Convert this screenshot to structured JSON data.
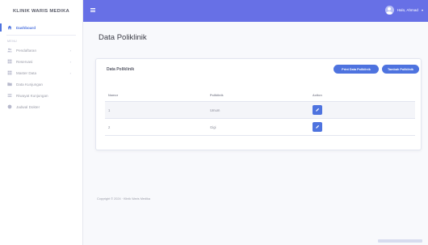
{
  "sidebar": {
    "brand": "KLINIK WARIS MEDIKA",
    "dashboard": "Dashboard",
    "heading": "MENU",
    "items": [
      {
        "label": "Pendaftaran",
        "icon": "users-icon",
        "chevron": "›"
      },
      {
        "label": "Reservasi",
        "icon": "table-icon",
        "chevron": "›"
      },
      {
        "label": "Master Data",
        "icon": "table-icon",
        "chevron": "›"
      },
      {
        "label": "Data Kunjungan",
        "icon": "folder-icon",
        "chevron": ""
      },
      {
        "label": "Riwayat Kunjungan",
        "icon": "list-icon",
        "chevron": ""
      },
      {
        "label": "Jadwal Dokter",
        "icon": "circle-icon",
        "chevron": ""
      }
    ]
  },
  "topbar": {
    "user_name": "Halo, Ahmad",
    "user_caret": "▾",
    "accent": "#6770e6"
  },
  "main": {
    "page_title": "Data Poliklinik",
    "card": {
      "title": "Data Poliklinik",
      "print_label": "Print Data Poliklinik",
      "add_label": "Tambah Poliklinik",
      "columns": [
        "Nomor",
        "Poliklinik",
        "Action"
      ],
      "rows": [
        {
          "no": "1",
          "poli": "Umum"
        },
        {
          "no": "2",
          "poli": "Gigi"
        }
      ]
    },
    "footer": "Copyright © 2024 · Klinik Waris Medika"
  }
}
